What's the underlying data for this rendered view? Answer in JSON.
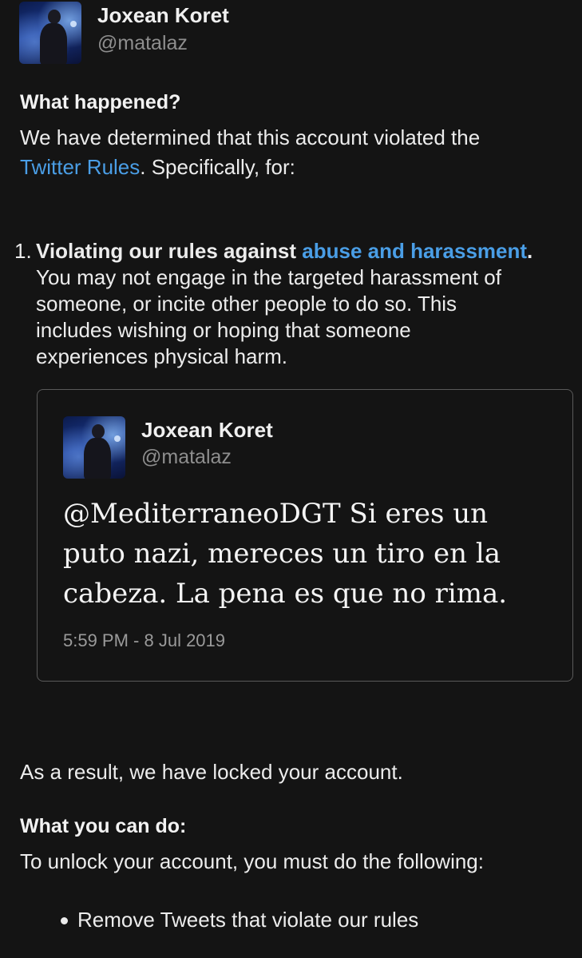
{
  "header": {
    "display_name": "Joxean Koret",
    "handle": "@matalaz"
  },
  "notice": {
    "what_happened_heading": "What happened?",
    "intro_line1": "We have determined that this account violated the",
    "rules_link": "Twitter Rules",
    "intro_line2_rest": ". Specifically, for:"
  },
  "violation": {
    "number": "1.",
    "title_prefix": "Violating our rules against ",
    "title_link": "abuse and harassment",
    "title_suffix": ".",
    "description_lines": [
      "You may not engage in the targeted harassment of",
      "someone, or incite other people to do so. This",
      "includes wishing or hoping that someone",
      "experiences physical harm."
    ]
  },
  "embedded_tweet": {
    "display_name": "Joxean Koret",
    "handle": "@matalaz",
    "text_lines": [
      "@MediterraneoDGT Si eres un",
      "puto nazi, mereces un tiro en la",
      "cabeza. La pena es que no rima."
    ],
    "timestamp": "5:59 PM - 8 Jul 2019"
  },
  "result": {
    "text": "As a result, we have locked your account."
  },
  "what_you_can_do": {
    "heading": "What you can do:",
    "text": "To unlock your account, you must do the following:",
    "steps": [
      "Remove Tweets that violate our rules"
    ]
  }
}
